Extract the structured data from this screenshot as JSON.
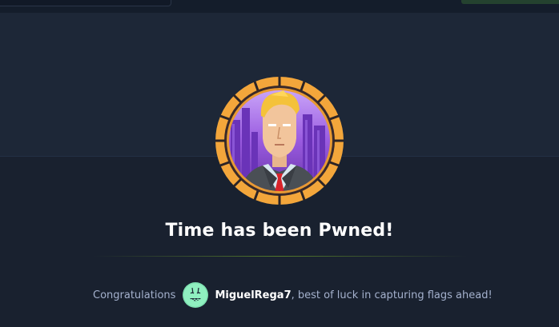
{
  "header": {
    "search_placeholder": "",
    "accent_color": "#9fef00"
  },
  "achievement": {
    "title": "Time has been Pwned!",
    "badge_icon": "machine-avatar-businessman-icon"
  },
  "message": {
    "prefix": "Congratulations",
    "username": "MiguelRega7",
    "suffix": ", best of luck in capturing flags ahead!",
    "user_avatar_icon": "green-ghost-avatar-icon"
  },
  "colors": {
    "background": "#1a2332",
    "badge_ring": "#f0a73a",
    "badge_inner": "#7b3fc4",
    "title_text": "#ffffff",
    "muted_text": "#a4b1cd"
  }
}
